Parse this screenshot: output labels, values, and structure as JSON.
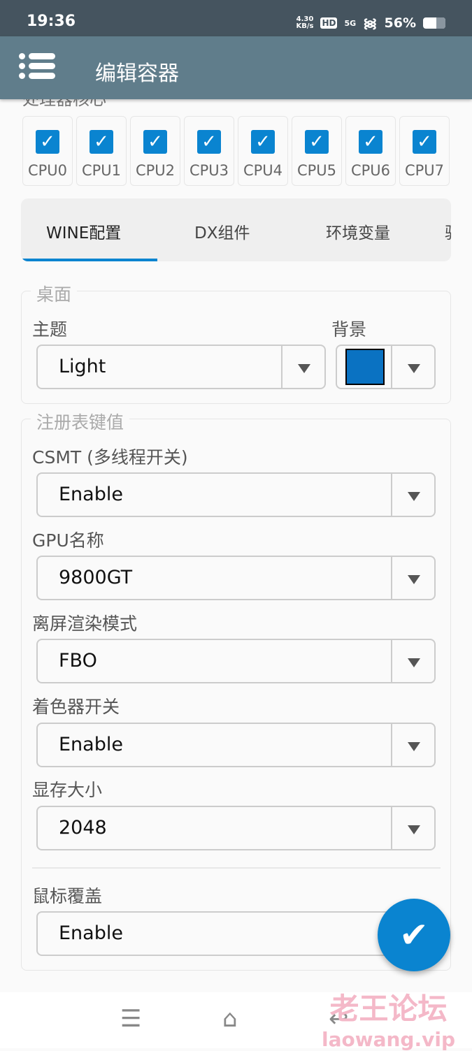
{
  "status_bar": {
    "time": "19:36",
    "speed": "4.30",
    "speed_unit": "KB/s",
    "hd": "HD",
    "network": "5G",
    "battery": "56%"
  },
  "app_bar": {
    "title": "编辑容器",
    "menu_icon": "menu-icon"
  },
  "cpu_section": {
    "label": "处理器核心",
    "cores": [
      {
        "label": "CPU0",
        "checked": true
      },
      {
        "label": "CPU1",
        "checked": true
      },
      {
        "label": "CPU2",
        "checked": true
      },
      {
        "label": "CPU3",
        "checked": true
      },
      {
        "label": "CPU4",
        "checked": true
      },
      {
        "label": "CPU5",
        "checked": true
      },
      {
        "label": "CPU6",
        "checked": true
      },
      {
        "label": "CPU7",
        "checked": true
      }
    ]
  },
  "tabs": [
    {
      "label": "WINE配置",
      "active": true
    },
    {
      "label": "DX组件"
    },
    {
      "label": "环境变量"
    },
    {
      "label": "驱"
    }
  ],
  "desktop": {
    "legend": "桌面",
    "theme_label": "主题",
    "theme_value": "Light",
    "background_label": "背景",
    "background_color": "#0a72c2"
  },
  "registry": {
    "legend": "注册表键值",
    "fields": [
      {
        "label": "CSMT (多线程开关)",
        "value": "Enable"
      },
      {
        "label": "GPU名称",
        "value": "9800GT"
      },
      {
        "label": "离屏渲染模式",
        "value": "FBO"
      },
      {
        "label": "着色器开关",
        "value": "Enable"
      },
      {
        "label": "显存大小",
        "value": "2048"
      }
    ],
    "mouse_label": "鼠标覆盖",
    "mouse_value": "Enable"
  },
  "fab": {
    "icon": "check-icon",
    "symbol": "✔"
  },
  "nav": {
    "recents": "☰",
    "home": "⌂",
    "back": "↩"
  },
  "watermark": {
    "line1": "老王论坛",
    "line2": "laowang.vip"
  },
  "accent": "#0a84d0"
}
